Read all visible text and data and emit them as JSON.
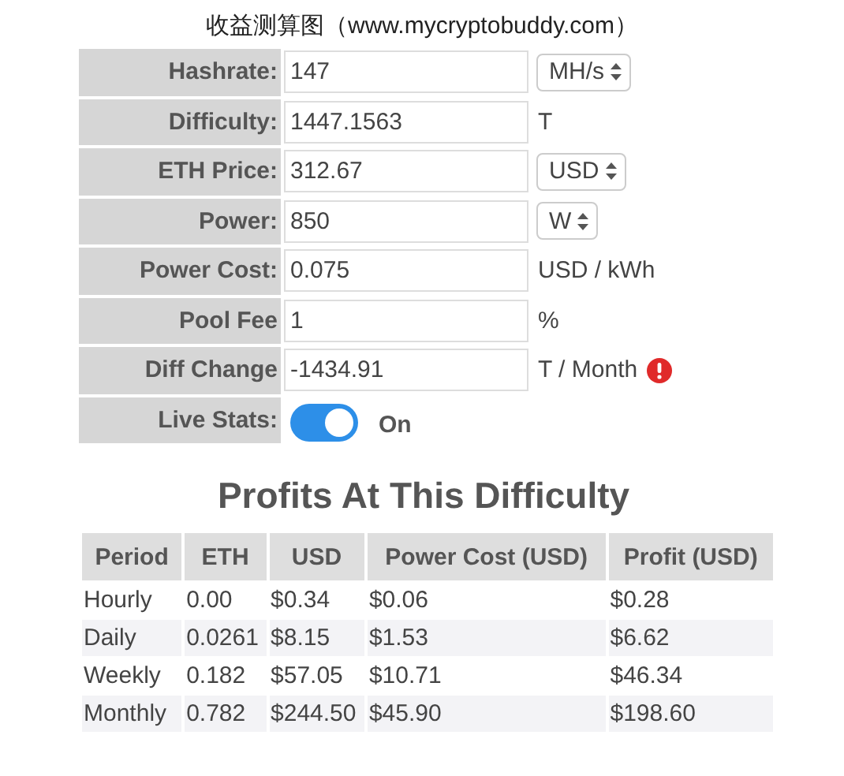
{
  "caption": "收益测算图（www.mycryptobuddy.com）",
  "form": [
    {
      "label": "Hashrate:",
      "value": "147",
      "kind": "select",
      "unit": "MH/s"
    },
    {
      "label": "Difficulty:",
      "value": "1447.1563",
      "kind": "text",
      "unit": "T"
    },
    {
      "label": "ETH Price:",
      "value": "312.67",
      "kind": "select",
      "unit": "USD"
    },
    {
      "label": "Power:",
      "value": "850",
      "kind": "select",
      "unit": "W"
    },
    {
      "label": "Power Cost:",
      "value": "0.075",
      "kind": "text",
      "unit": "USD / kWh"
    },
    {
      "label": "Pool Fee",
      "value": "1",
      "kind": "text",
      "unit": "%"
    },
    {
      "label": "Diff Change",
      "value": "-1434.91",
      "kind": "warning",
      "unit": "T / Month"
    },
    {
      "label": "Live Stats:",
      "kind": "toggle",
      "on": true,
      "state_text": "On"
    }
  ],
  "profits": {
    "title": "Profits At This Difficulty",
    "columns": [
      "Period",
      "ETH",
      "USD",
      "Power Cost (USD)",
      "Profit (USD)"
    ],
    "rows": [
      [
        "Hourly",
        "0.00",
        "$0.34",
        "$0.06",
        "$0.28"
      ],
      [
        "Daily",
        "0.0261",
        "$8.15",
        "$1.53",
        "$6.62"
      ],
      [
        "Weekly",
        "0.182",
        "$57.05",
        "$10.71",
        "$46.34"
      ],
      [
        "Monthly",
        "0.782",
        "$244.50",
        "$45.90",
        "$198.60"
      ]
    ]
  }
}
